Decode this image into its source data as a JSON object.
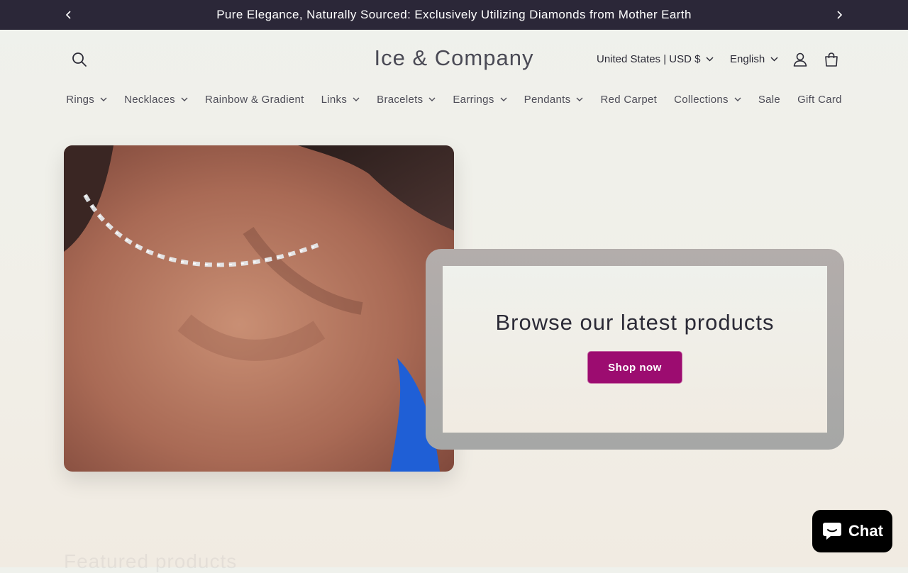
{
  "announcement": {
    "text": "Pure Elegance, Naturally Sourced: Exclusively Utilizing Diamonds from Mother Earth",
    "prev_icon": "chevron-left-icon",
    "next_icon": "chevron-right-icon"
  },
  "header": {
    "logo": "Ice & Company",
    "search_icon": "search-icon",
    "country_selector": "United States | USD $",
    "language_selector": "English",
    "account_icon": "user-icon",
    "cart_icon": "bag-icon"
  },
  "nav": {
    "items": [
      {
        "label": "Rings",
        "has_dropdown": true
      },
      {
        "label": "Necklaces",
        "has_dropdown": true
      },
      {
        "label": "Rainbow & Gradient",
        "has_dropdown": false
      },
      {
        "label": "Links",
        "has_dropdown": true
      },
      {
        "label": "Bracelets",
        "has_dropdown": true
      },
      {
        "label": "Earrings",
        "has_dropdown": true
      },
      {
        "label": "Pendants",
        "has_dropdown": true
      },
      {
        "label": "Red Carpet",
        "has_dropdown": false
      },
      {
        "label": "Collections",
        "has_dropdown": true
      },
      {
        "label": "Sale",
        "has_dropdown": false
      },
      {
        "label": "Gift Card",
        "has_dropdown": false
      }
    ]
  },
  "hero": {
    "heading": "Browse our latest products",
    "button_label": "Shop now"
  },
  "featured": {
    "heading": "Featured products"
  },
  "chat": {
    "label": "Chat",
    "icon": "chat-bubble-icon"
  },
  "colors": {
    "announcement_bg": "#2b2738",
    "accent": "#9c0c70",
    "page_bg": "#eff1ec",
    "chat_bg": "#000000"
  }
}
